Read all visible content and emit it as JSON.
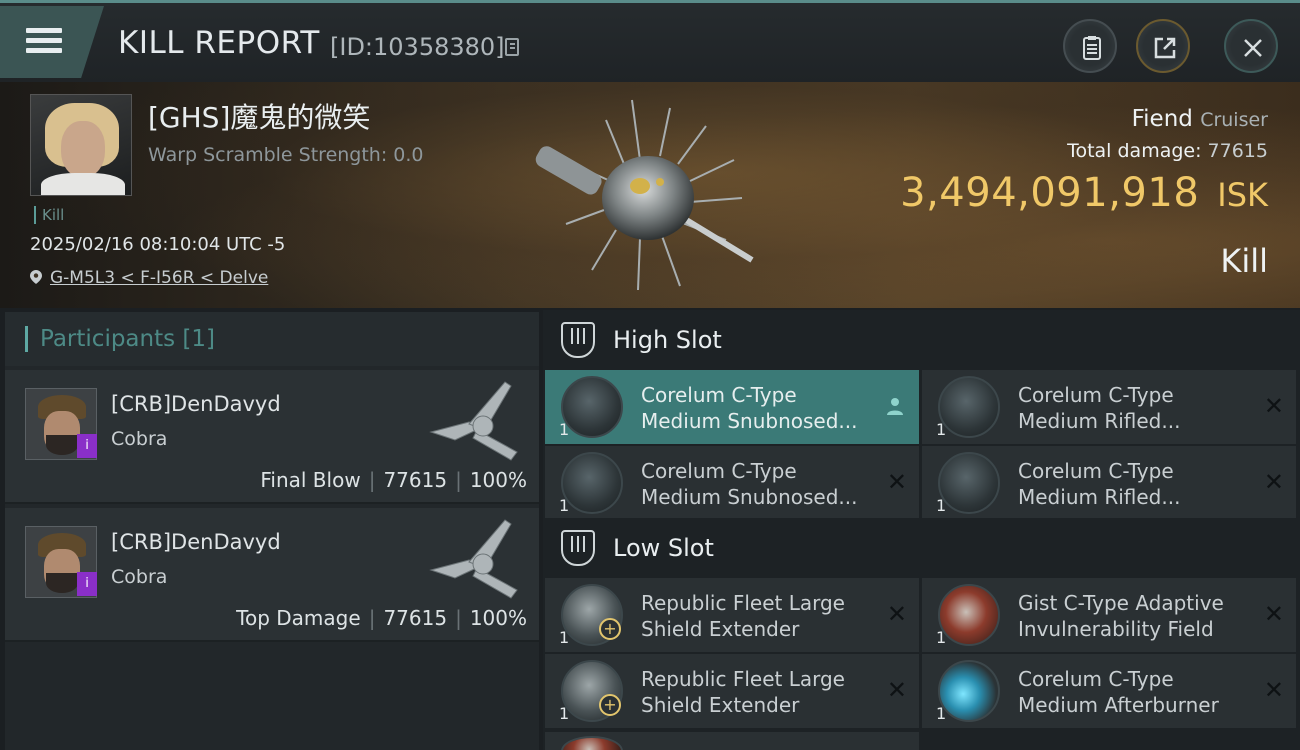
{
  "header": {
    "title": "KILL REPORT",
    "report_id": "[ID:10358380]"
  },
  "victim": {
    "name": "[GHS]魔鬼的微笑",
    "warp_scramble": "Warp Scramble Strength: 0.0",
    "tag": "Kill",
    "datetime": "2025/02/16 08:10:04 UTC -5",
    "location": "G-M5L3 < F-I56R < Delve",
    "ship_name": "Fiend",
    "ship_class": "Cruiser",
    "total_damage_label": "Total damage:",
    "total_damage": "77615",
    "isk_value": "3,494,091,918",
    "isk_unit": "ISK",
    "result": "Kill"
  },
  "participants": {
    "title": "Participants [1]",
    "rows": [
      {
        "name": "[CRB]DenDavyd",
        "ship": "Cobra",
        "role": "Final Blow",
        "damage": "77615",
        "percent": "100%",
        "badge": "i"
      },
      {
        "name": "[CRB]DenDavyd",
        "ship": "Cobra",
        "role": "Top Damage",
        "damage": "77615",
        "percent": "100%",
        "badge": "i"
      }
    ]
  },
  "slots": {
    "high_label": "High Slot",
    "low_label": "Low Slot",
    "high_items": [
      {
        "line1": "Corelum C-Type",
        "line2": "Medium Snubnosed...",
        "qty": "1",
        "icon": "turret-icon"
      },
      {
        "line1": "Corelum C-Type",
        "line2": "Medium Rifled...",
        "qty": "1",
        "icon": "turret-icon"
      },
      {
        "line1": "Corelum C-Type",
        "line2": "Medium Snubnosed...",
        "qty": "1",
        "icon": "turret-icon"
      },
      {
        "line1": "Corelum C-Type",
        "line2": "Medium Rifled...",
        "qty": "1",
        "icon": "turret-icon"
      }
    ],
    "low_items": [
      {
        "line1": "Republic Fleet Large",
        "line2": "Shield Extender",
        "qty": "1",
        "icon": "shield-extender-icon"
      },
      {
        "line1": "Gist C-Type Adaptive",
        "line2": "Invulnerability Field",
        "qty": "1",
        "icon": "invulnerability-field-icon"
      },
      {
        "line1": "Republic Fleet Large",
        "line2": "Shield Extender",
        "qty": "1",
        "icon": "shield-extender-icon"
      },
      {
        "line1": "Corelum C-Type",
        "line2": "Medium Afterburner",
        "qty": "1",
        "icon": "afterburner-icon"
      }
    ],
    "drop_mark": "✕"
  },
  "colors": {
    "accent": "#5ea9a4",
    "isk_gold": "#f0c868",
    "selected_row": "#3b7a77",
    "badge_purple": "#8a2fc8"
  }
}
